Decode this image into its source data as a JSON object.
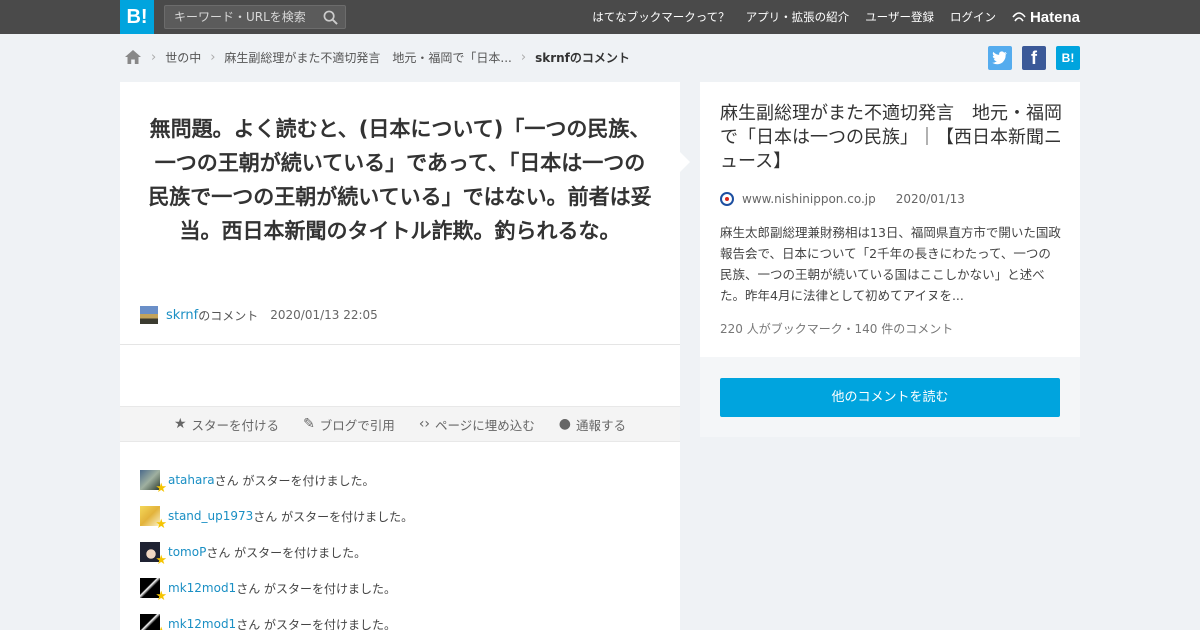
{
  "header": {
    "logo_text": "B!",
    "search_placeholder": "キーワード・URLを検索",
    "search_icon": "search-icon",
    "nav": [
      {
        "label": "はてなブックマークって？"
      },
      {
        "label": "アプリ・拡張の紹介"
      },
      {
        "label": "ユーザー登録"
      },
      {
        "label": "ログイン"
      }
    ],
    "brand": "Hatena",
    "brand_icon": "hatena-logo-icon"
  },
  "breadcrumb": {
    "home_icon": "home-icon",
    "items": [
      "世の中",
      "麻生副総理がまた不適切発言　地元・福岡で「日本...",
      "skrnfのコメント"
    ]
  },
  "share": {
    "twitter": "t",
    "facebook": "f",
    "hatena": "B!"
  },
  "comment": {
    "text": "無問題。よく読むと、(日本について)「一つの民族、一つの王朝が続いている」であって、「日本は一つの民族で一つの王朝が続いている」ではない。前者は妥当。西日本新聞のタイトル詐欺。釣られるな。",
    "user": "skrnf",
    "user_suffix": "のコメント",
    "date": "2020/01/13 22:05"
  },
  "actions": [
    {
      "icon": "star-icon",
      "label": "スターを付ける"
    },
    {
      "icon": "pencil-icon",
      "label": "ブログで引用"
    },
    {
      "icon": "code-icon",
      "label": "ページに埋め込む"
    },
    {
      "icon": "report-icon",
      "label": "通報する"
    }
  ],
  "stars": {
    "suffix": "さん がスターを付けました。",
    "items": [
      {
        "user": "atahara"
      },
      {
        "user": "stand_up1973"
      },
      {
        "user": "tomoP"
      },
      {
        "user": "mk12mod1"
      },
      {
        "user": "mk12mod1"
      }
    ]
  },
  "article": {
    "title": "麻生副総理がまた不適切発言　地元・福岡で「日本は一つの民族」｜【西日本新聞ニュース】",
    "domain": "www.nishinippon.co.jp",
    "date": "2020/01/13",
    "description": "麻生太郎副総理兼財務相は13日、福岡県直方市で開いた国政報告会で、日本について「2千年の長きにわたって、一つの民族、一つの王朝が続いている国はここしかない」と述べた。昨年4月に法律として初めてアイヌを...",
    "counts": "220 人がブックマーク・140 件のコメント",
    "read_more": "他のコメントを読む"
  },
  "colors": {
    "accent": "#00a4de",
    "topbar": "#4a4a4a",
    "link": "#1a8fc4",
    "star": "#f5c400"
  }
}
